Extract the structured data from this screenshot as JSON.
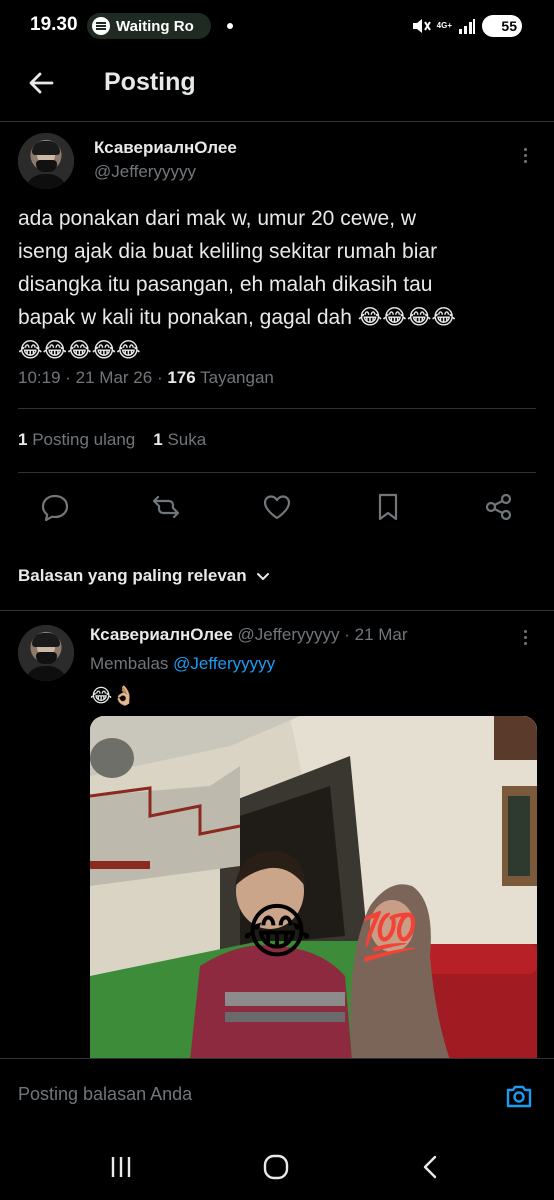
{
  "status_bar": {
    "time": "19.30",
    "media_pill": "Waiting Ro",
    "network": "4G+",
    "battery": "55",
    "icons": [
      "spotify-icon",
      "mute-icon",
      "signal-icon",
      "battery-icon"
    ]
  },
  "header": {
    "title": "Posting",
    "back_icon": "arrow-left-icon"
  },
  "tweet": {
    "display_name": "КсавериалнОлее",
    "handle": "@Jefferyyyyy",
    "text_line1": "ada ponakan dari mak w, umur 20 cewe, w",
    "text_line2": "iseng ajak dia buat keliling sekitar rumah biar",
    "text_line3": "disangka itu pasangan, eh malah dikasih tau",
    "text_line4": "bapak w kali itu ponakan, gagal dah 😂😂😂😂",
    "text_line5": "😂😂😂😂😂",
    "time": "10:19",
    "date": "21 Mar 26",
    "views": "176",
    "views_label": "Tayangan",
    "reposts_count": "1",
    "reposts_label": "Posting ulang",
    "likes_count": "1",
    "likes_label": "Suka"
  },
  "actions": [
    "reply-icon",
    "repost-icon",
    "like-icon",
    "bookmark-icon",
    "share-icon"
  ],
  "replies_filter": {
    "label": "Balasan yang paling relevan"
  },
  "reply": {
    "display_name": "КсавериалнОлее",
    "handle": "@Jefferyyyyy",
    "date": "21 Mar",
    "replying_prefix": "Membalas",
    "replying_to": "@Jefferyyyyy",
    "text": "😂👌🏼",
    "photo_stickers": [
      "😂",
      "💯"
    ]
  },
  "composer": {
    "placeholder": "Posting balasan Anda"
  },
  "colors": {
    "background": "#000000",
    "text": "#e7e9ea",
    "secondary": "#71767b",
    "link": "#1d9bf0",
    "divider": "#2f3336"
  }
}
